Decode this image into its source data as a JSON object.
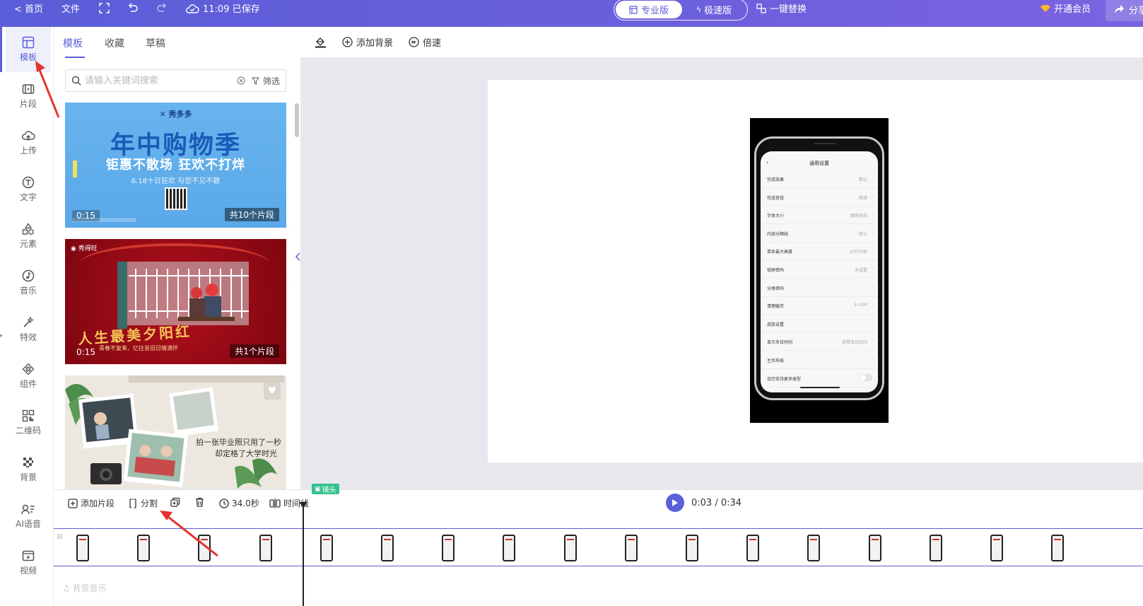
{
  "topbar": {
    "home": "< 首页",
    "file": "文件",
    "save_status": "11:09 已保存",
    "pro_version": "专业版",
    "fast_version": "极速版",
    "one_click_replace": "一键替换",
    "vip": "开通会员",
    "share": "分享",
    "icons": [
      "fullscreen-icon",
      "undo-icon",
      "redo-icon",
      "cloud-save-icon",
      "diamond-icon",
      "share-arrow-icon"
    ]
  },
  "rail": {
    "items": [
      {
        "label": "模板",
        "icon": "template-icon"
      },
      {
        "label": "片段",
        "icon": "clip-icon"
      },
      {
        "label": "上传",
        "icon": "upload-icon"
      },
      {
        "label": "文字",
        "icon": "text-icon"
      },
      {
        "label": "元素",
        "icon": "shapes-icon"
      },
      {
        "label": "音乐",
        "icon": "music-icon"
      },
      {
        "label": "特效",
        "icon": "magic-wand-icon"
      },
      {
        "label": "组件",
        "icon": "component-icon"
      },
      {
        "label": "二维码",
        "icon": "qrcode-icon"
      },
      {
        "label": "背景",
        "icon": "background-icon"
      },
      {
        "label": "AI语音",
        "icon": "ai-voice-icon"
      },
      {
        "label": "视频",
        "icon": "video-icon"
      }
    ]
  },
  "panel": {
    "tabs": [
      "模板",
      "收藏",
      "草稿"
    ],
    "search_placeholder": "请输入关键词搜索",
    "filter": "筛选",
    "cards": [
      {
        "brand": "秀多多",
        "title": "年中购物季",
        "subtitle": "钜惠不散场 狂欢不打烊",
        "small": "6.18十日狂欢 与您不见不散",
        "duration": "0:15",
        "segments": "共10个片段"
      },
      {
        "calligraphy": "人生最美夕阳红",
        "note": "青春不复来，忆往昔旧日情满怀",
        "duration": "0:15",
        "segments": "共1个片段"
      },
      {
        "text_line1": "拍一张毕业照只用了一秒",
        "text_line2": "却定格了大学时光"
      }
    ]
  },
  "toolbar": {
    "add_background": "添加背景",
    "speed": "倍速"
  },
  "phone_screen": {
    "title": "通用设置",
    "rows": [
      {
        "key": "完成效果",
        "value": "默认"
      },
      {
        "key": "完成音效",
        "value": "雨滴"
      },
      {
        "key": "字体大小",
        "value": "跟随系统"
      },
      {
        "key": "内容分隔线",
        "value": "默认"
      },
      {
        "key": "单条最大高度",
        "value": "10行内容"
      },
      {
        "key": "锁屏密码",
        "value": "未设置"
      },
      {
        "key": "分类密码",
        "value": ""
      },
      {
        "key": "清理缓存",
        "value": "6.00M"
      },
      {
        "key": "皮肤设置",
        "value": ""
      },
      {
        "key": "显示多日时间",
        "value": "按精准日时间"
      },
      {
        "key": "主页布局",
        "value": ""
      },
      {
        "key": "日历支持更多类型",
        "value": ""
      }
    ]
  },
  "timeline": {
    "add_clip": "添加片段",
    "split": "分割",
    "duration": "34.0秒",
    "timeline_label": "时间线",
    "shot_tag": "镜头",
    "current_time": "0:03",
    "total_time": "0:34",
    "time_separator": "/",
    "audio_placeholder": "背景音乐",
    "thumb_count": 17
  },
  "colors": {
    "accent": "#5b5fd8",
    "topbar_start": "#5a5ed8",
    "topbar_end": "#7b63e0",
    "annotation_arrow": "#e5322d"
  }
}
